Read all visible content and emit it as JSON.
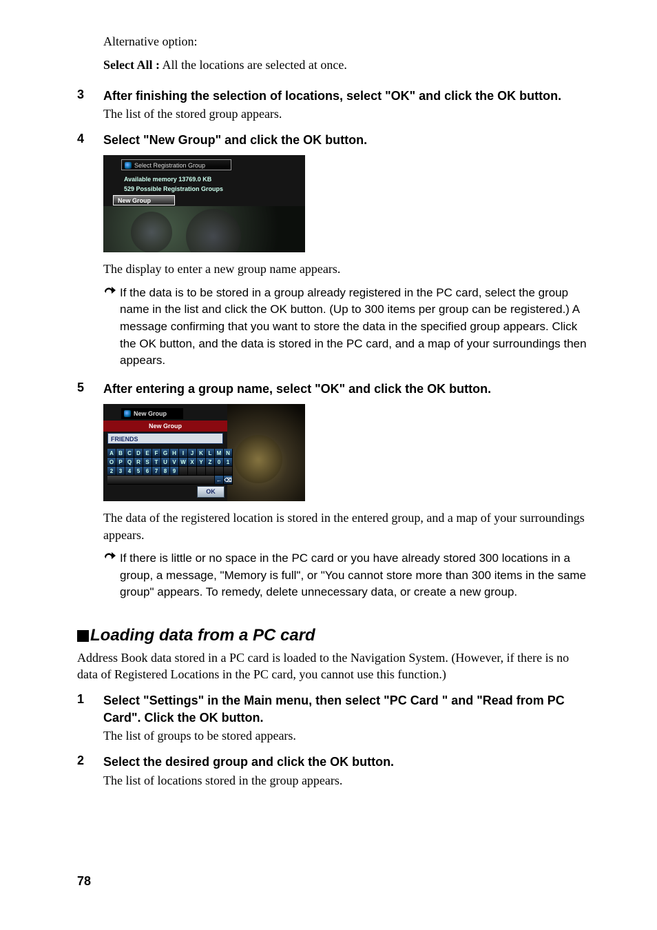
{
  "intro": {
    "alt_option_label": "Alternative option:",
    "select_all_label": "Select All :",
    "select_all_text": "  All the locations are selected at once."
  },
  "steps_a": [
    {
      "num": "3",
      "title": "After finishing the selection of locations, select \"OK\" and click the OK button.",
      "text": "The list of the stored group appears."
    },
    {
      "num": "4",
      "title": "Select \"New Group\" and click the OK button.",
      "text": ""
    }
  ],
  "figure1": {
    "title": "Select Registration Group",
    "line1": "Available memory 13769.0 KB",
    "line2": "529 Possible Registration Groups",
    "tab": "New Group"
  },
  "after_fig1": "The display to enter a new group name appears.",
  "note1": "If the data is to be stored in a group already registered in the PC card, select the group name in the list and click the OK button. (Up to 300 items per group can be registered.) A message confirming that you want to store the data in the specified group appears. Click the OK button, and the data is stored in the PC card, and a map of your surroundings then appears.",
  "steps_b": [
    {
      "num": "5",
      "title": "After entering a group name, select \"OK\" and click the OK button.",
      "text": ""
    }
  ],
  "figure2": {
    "title": "New Group",
    "header": "New Group",
    "input_value": "FRIENDS",
    "ok_label": "OK",
    "rows": [
      [
        "A",
        "B",
        "C",
        "D",
        "E",
        "F",
        "G",
        "H",
        "I",
        "J",
        "K",
        "L",
        "M",
        "N"
      ],
      [
        "O",
        "P",
        "Q",
        "R",
        "S",
        "T",
        "U",
        "V",
        "W",
        "X",
        "Y",
        "Z",
        "0",
        "1"
      ],
      [
        "2",
        "3",
        "4",
        "5",
        "6",
        "7",
        "8",
        "9",
        "",
        "",
        "",
        "",
        "",
        ""
      ]
    ],
    "arrow_left": "←",
    "arrow_del": "⌫"
  },
  "after_fig2": "The data of the registered location is stored in the entered group, and a map of your surroundings appears.",
  "note2": "If there is little or no space in the PC card or you have already stored 300 locations in a group, a message, \"Memory is full\", or \"You cannot store more than 300 items in the same group\" appears. To remedy, delete unnecessary data, or create a new group.",
  "section": {
    "title": "Loading data from a PC card",
    "text": "Address Book data stored in a PC card is loaded to the Navigation System. (However, if there is no data of Registered Locations in the PC card, you cannot use this function.)"
  },
  "steps_c": [
    {
      "num": "1",
      "title": "Select \"Settings\" in the Main menu, then select \"PC Card \" and \"Read from PC Card\". Click the OK button.",
      "text": "The list of groups to be stored appears."
    },
    {
      "num": "2",
      "title": "Select the desired group and click the OK button.",
      "text": "The list of locations stored in the group appears."
    }
  ],
  "page_number": "78"
}
